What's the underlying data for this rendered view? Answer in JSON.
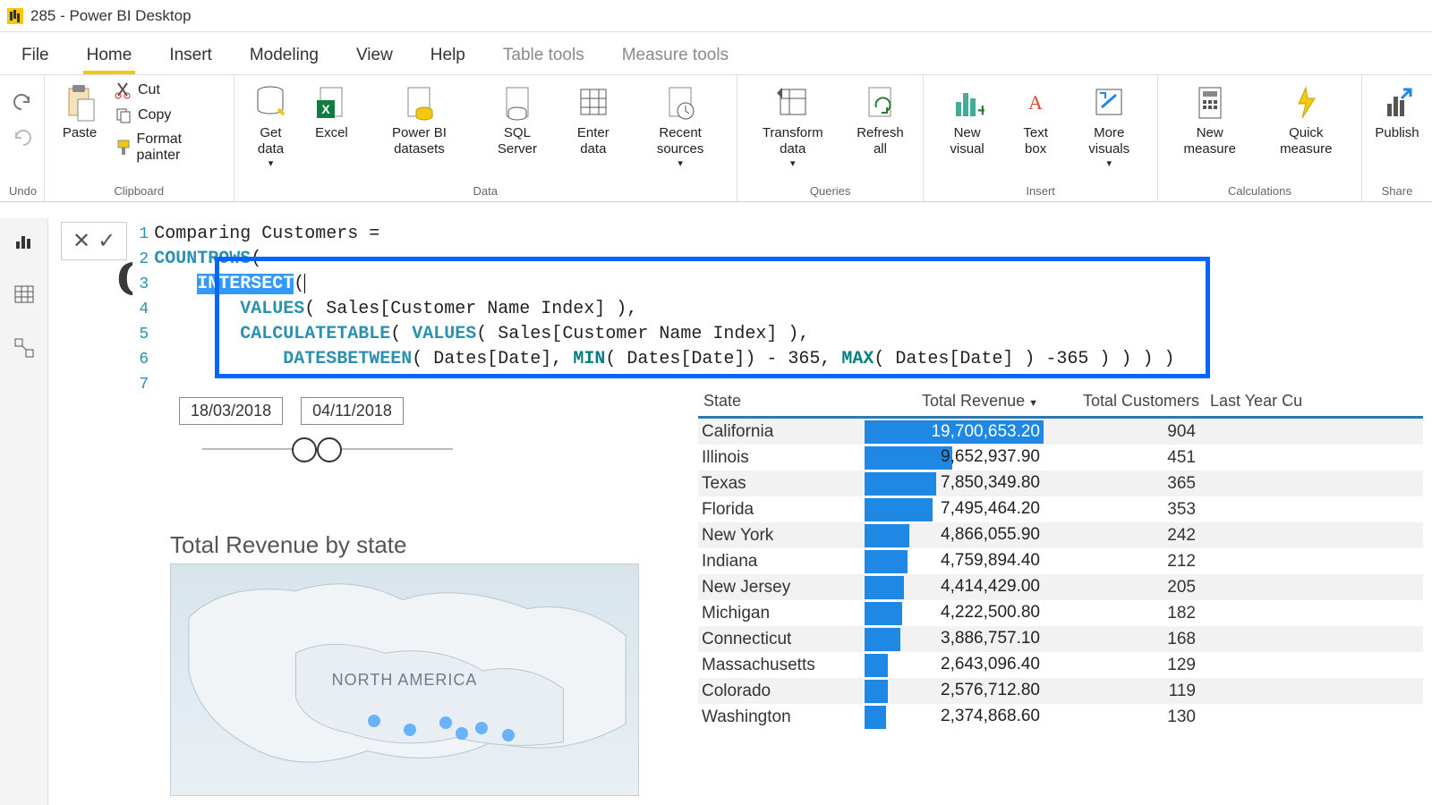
{
  "title": "285 - Power BI Desktop",
  "menu": {
    "file": "File",
    "home": "Home",
    "insert": "Insert",
    "modeling": "Modeling",
    "view": "View",
    "help": "Help",
    "table_tools": "Table tools",
    "measure_tools": "Measure tools"
  },
  "ribbon": {
    "undo_label": "Undo",
    "clipboard": {
      "paste": "Paste",
      "cut": "Cut",
      "copy": "Copy",
      "format_painter": "Format painter",
      "label": "Clipboard"
    },
    "data": {
      "get_data": "Get\ndata",
      "excel": "Excel",
      "pbi_ds": "Power BI\ndatasets",
      "sql": "SQL\nServer",
      "enter": "Enter\ndata",
      "recent": "Recent\nsources",
      "label": "Data"
    },
    "queries": {
      "transform": "Transform\ndata",
      "refresh": "Refresh\nall",
      "label": "Queries"
    },
    "insert": {
      "new_visual": "New\nvisual",
      "text_box": "Text\nbox",
      "more": "More\nvisuals",
      "label": "Insert"
    },
    "calc": {
      "new_measure": "New\nmeasure",
      "quick": "Quick\nmeasure",
      "label": "Calculations"
    },
    "share": {
      "publish": "Publish",
      "label": "Share"
    }
  },
  "formula": {
    "lines": [
      {
        "n": "1",
        "plain": "Comparing Customers ="
      },
      {
        "n": "2",
        "html": "<span class='fn'>COUNTROWS</span>("
      },
      {
        "n": "3",
        "html": "    <span class='fn sel'>INTERSECT</span>(<span class='cursor-bar'></span>"
      },
      {
        "n": "4",
        "html": "        <span class='fn'>VALUES</span>( Sales[Customer Name Index] ),"
      },
      {
        "n": "5",
        "html": "        <span class='fn'>CALCULATETABLE</span>( <span class='fn'>VALUES</span>( Sales[Customer Name Index] ),"
      },
      {
        "n": "6",
        "html": "            <span class='fn'>DATESBETWEEN</span>( Dates[Date], <span class='fn2'>MIN</span>( Dates[Date]) - 365, <span class='fn2'>MAX</span>( Dates[Date] ) -365 ) ) ) )"
      },
      {
        "n": "7",
        "plain": ""
      }
    ]
  },
  "heading": "Co",
  "slicer": {
    "from": "18/03/2018",
    "to": "04/11/2018"
  },
  "chart_title": "Total Revenue by state",
  "map_label": "NORTH AMERICA",
  "table": {
    "headers": {
      "state": "State",
      "rev": "Total Revenue",
      "cust": "Total Customers",
      "last": "Last Year Cu"
    }
  },
  "chart_data": {
    "type": "table",
    "title": "Total Revenue by state",
    "columns": [
      "State",
      "Total Revenue",
      "Total Customers"
    ],
    "rows": [
      {
        "state": "California",
        "revenue": 19700653.2,
        "revenue_fmt": "19,700,653.20",
        "customers": 904,
        "bar_pct": 100
      },
      {
        "state": "Illinois",
        "revenue": 9652937.9,
        "revenue_fmt": "9,652,937.90",
        "customers": 451,
        "bar_pct": 49
      },
      {
        "state": "Texas",
        "revenue": 7850349.8,
        "revenue_fmt": "7,850,349.80",
        "customers": 365,
        "bar_pct": 40
      },
      {
        "state": "Florida",
        "revenue": 7495464.2,
        "revenue_fmt": "7,495,464.20",
        "customers": 353,
        "bar_pct": 38
      },
      {
        "state": "New York",
        "revenue": 4866055.9,
        "revenue_fmt": "4,866,055.90",
        "customers": 242,
        "bar_pct": 25
      },
      {
        "state": "Indiana",
        "revenue": 4759894.4,
        "revenue_fmt": "4,759,894.40",
        "customers": 212,
        "bar_pct": 24
      },
      {
        "state": "New Jersey",
        "revenue": 4414429.0,
        "revenue_fmt": "4,414,429.00",
        "customers": 205,
        "bar_pct": 22
      },
      {
        "state": "Michigan",
        "revenue": 4222500.8,
        "revenue_fmt": "4,222,500.80",
        "customers": 182,
        "bar_pct": 21
      },
      {
        "state": "Connecticut",
        "revenue": 3886757.1,
        "revenue_fmt": "3,886,757.10",
        "customers": 168,
        "bar_pct": 20
      },
      {
        "state": "Massachusetts",
        "revenue": 2643096.4,
        "revenue_fmt": "2,643,096.40",
        "customers": 129,
        "bar_pct": 13
      },
      {
        "state": "Colorado",
        "revenue": 2576712.8,
        "revenue_fmt": "2,576,712.80",
        "customers": 119,
        "bar_pct": 13
      },
      {
        "state": "Washington",
        "revenue": 2374868.6,
        "revenue_fmt": "2,374,868.60",
        "customers": 130,
        "bar_pct": 12
      }
    ]
  }
}
